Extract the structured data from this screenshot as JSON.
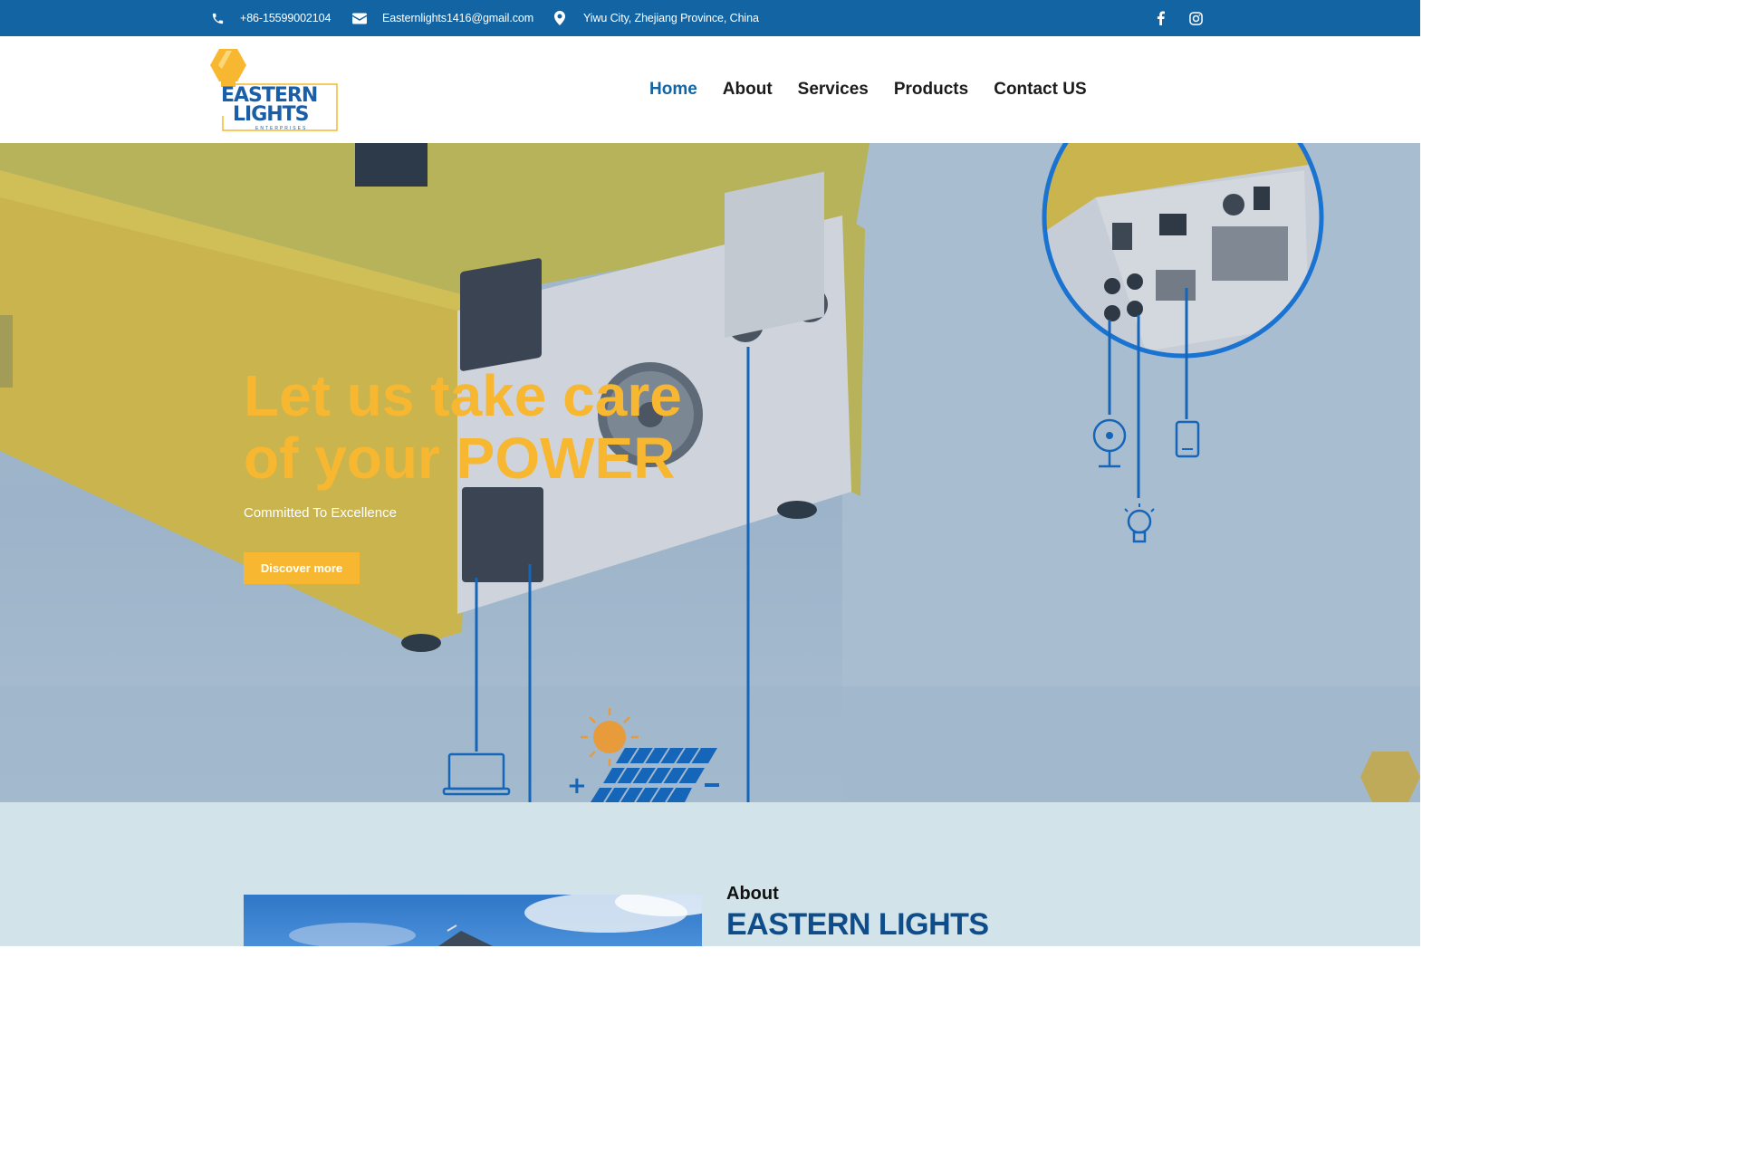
{
  "topbar": {
    "phone": "+86-15599002104",
    "email": "Easternlights1416@gmail.com",
    "address": "Yiwu City, Zhejiang Province, China",
    "social_icons": [
      "facebook-icon",
      "instagram-icon"
    ]
  },
  "logo": {
    "line1": "EASTERN",
    "line2": "LIGHTS",
    "tagline": "ENTERPRISES"
  },
  "nav": {
    "items": [
      {
        "label": "Home",
        "active": true
      },
      {
        "label": "About",
        "active": false
      },
      {
        "label": "Services",
        "active": false
      },
      {
        "label": "Products",
        "active": false
      },
      {
        "label": "Contact US",
        "active": false
      }
    ]
  },
  "hero": {
    "title_line1": "Let us take care",
    "title_line2": "of your POWER",
    "subtitle": "Committed To Excellence",
    "button_label": "Discover more"
  },
  "about": {
    "label": "About",
    "heading": "EASTERN LIGHTS"
  },
  "colors": {
    "primary_blue": "#1264a3",
    "accent_yellow": "#f7b731",
    "hero_bg": "#a4b9cd",
    "about_bg": "#d2e4e9"
  }
}
